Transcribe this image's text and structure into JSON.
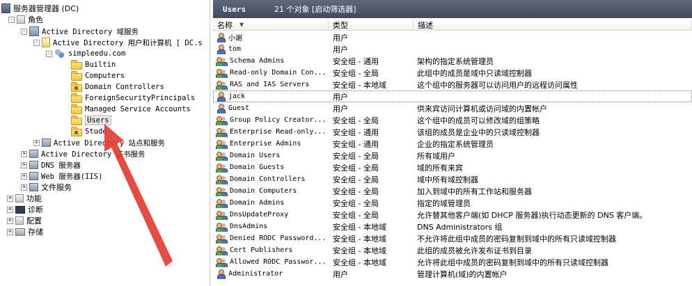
{
  "tree": {
    "nodes": [
      {
        "label": "服务器管理器 (DC)",
        "icon": "server-manager-icon",
        "exp": "none"
      },
      {
        "label": "角色",
        "icon": "role-icon",
        "exp": "-"
      },
      {
        "label": "Active Directory 域服务",
        "icon": "ad-icon",
        "exp": "-"
      },
      {
        "label": "Active Directory 用户和计算机 [ DC.s",
        "icon": "book-icon",
        "exp": "-"
      },
      {
        "label": "simpleedu.com",
        "icon": "domain-icon",
        "exp": "-"
      },
      {
        "label": "Builtin",
        "icon": "folder-icon",
        "exp": "none"
      },
      {
        "label": "Computers",
        "icon": "folder-icon",
        "exp": "none"
      },
      {
        "label": "Domain Controllers",
        "icon": "ou-folder-icon",
        "exp": "none"
      },
      {
        "label": "ForeignSecurityPrincipals",
        "icon": "folder-icon",
        "exp": "none"
      },
      {
        "label": "Managed Service Accounts",
        "icon": "folder-icon",
        "exp": "none"
      },
      {
        "label": "Users",
        "icon": "folder-icon",
        "exp": "none"
      },
      {
        "label": "Stude",
        "icon": "ou-folder-icon",
        "exp": "none"
      },
      {
        "label": "Active Directory 站点和服务",
        "icon": "ad-sites-icon",
        "exp": "+"
      },
      {
        "label": "Active Directory 证书服务",
        "icon": "cert-icon",
        "exp": "+"
      },
      {
        "label": "DNS 服务器",
        "icon": "dns-icon",
        "exp": "+"
      },
      {
        "label": "Web 服务器(IIS)",
        "icon": "web-icon",
        "exp": "+"
      },
      {
        "label": "文件服务",
        "icon": "file-service-icon",
        "exp": "+"
      },
      {
        "label": "功能",
        "icon": "feature-icon",
        "exp": "+"
      },
      {
        "label": "诊断",
        "icon": "diagnostics-icon",
        "exp": "+"
      },
      {
        "label": "配置",
        "icon": "config-icon",
        "exp": "+"
      },
      {
        "label": "存储",
        "icon": "storage-icon",
        "exp": "+"
      }
    ]
  },
  "list": {
    "title": "Users",
    "count": "21 个对象  [启动筛选器]",
    "columns": {
      "name": "名称",
      "type": "类型",
      "desc": "描述"
    },
    "rows": [
      {
        "name": "小谢",
        "type": "用户",
        "desc": "",
        "kind": "user"
      },
      {
        "name": "tom",
        "type": "用户",
        "desc": "",
        "kind": "user"
      },
      {
        "name": "Schema Admins",
        "type": "安全组 - 通用",
        "desc": "架构的指定系统管理员",
        "kind": "group"
      },
      {
        "name": "Read-only Domain Con...",
        "type": "安全组 - 全局",
        "desc": "此组中的成员是域中只读域控制器",
        "kind": "group"
      },
      {
        "name": "RAS and IAS Servers",
        "type": "安全组 - 本地域",
        "desc": "这个组中的服务器可以访问用户的远程访问属性",
        "kind": "group"
      },
      {
        "name": "jack",
        "type": "用户",
        "desc": "",
        "kind": "user"
      },
      {
        "name": "Guest",
        "type": "用户",
        "desc": "供来宾访问计算机或访问域的内置帐户",
        "kind": "user"
      },
      {
        "name": "Group Policy Creator...",
        "type": "安全组 - 全局",
        "desc": "这个组中的成员可以修改域的组策略",
        "kind": "group"
      },
      {
        "name": "Enterprise Read-only...",
        "type": "安全组 - 通用",
        "desc": "该组的成员是企业中的只读域控制器",
        "kind": "group"
      },
      {
        "name": "Enterprise Admins",
        "type": "安全组 - 通用",
        "desc": "企业的指定系统管理员",
        "kind": "group"
      },
      {
        "name": "Domain Users",
        "type": "安全组 - 全局",
        "desc": "所有域用户",
        "kind": "group"
      },
      {
        "name": "Domain Guests",
        "type": "安全组 - 全局",
        "desc": "域的所有来宾",
        "kind": "group"
      },
      {
        "name": "Domain Controllers",
        "type": "安全组 - 全局",
        "desc": "域中所有域控制器",
        "kind": "group"
      },
      {
        "name": "Domain Computers",
        "type": "安全组 - 全局",
        "desc": "加入到域中的所有工作站和服务器",
        "kind": "group"
      },
      {
        "name": "Domain Admins",
        "type": "安全组 - 全局",
        "desc": "指定的域管理员",
        "kind": "group"
      },
      {
        "name": "DnsUpdateProxy",
        "type": "安全组 - 全局",
        "desc": "允许替其他客户端(如 DHCP 服务器)执行动态更新的 DNS 客户端。",
        "kind": "group"
      },
      {
        "name": "DnsAdmins",
        "type": "安全组 - 本地域",
        "desc": "DNS Administrators 组",
        "kind": "group"
      },
      {
        "name": "Denied RODC Password...",
        "type": "安全组 - 本地域",
        "desc": "不允许将此组中成员的密码复制到域中的所有只读域控制器",
        "kind": "group"
      },
      {
        "name": "Cert Publishers",
        "type": "安全组 - 本地域",
        "desc": "此组的成员被允许发布证书到目录",
        "kind": "group"
      },
      {
        "name": "Allowed RODC Passwor...",
        "type": "安全组 - 本地域",
        "desc": "允许将此组中成员的密码复制到域中的所有只读域控制器",
        "kind": "group"
      },
      {
        "name": "Administrator",
        "type": "用户",
        "desc": "管理计算机(域)的内置帐户",
        "kind": "user"
      }
    ]
  },
  "colors": {
    "header_bg": "#4f5a6b",
    "annotation_arrow": "#e23a2e"
  }
}
